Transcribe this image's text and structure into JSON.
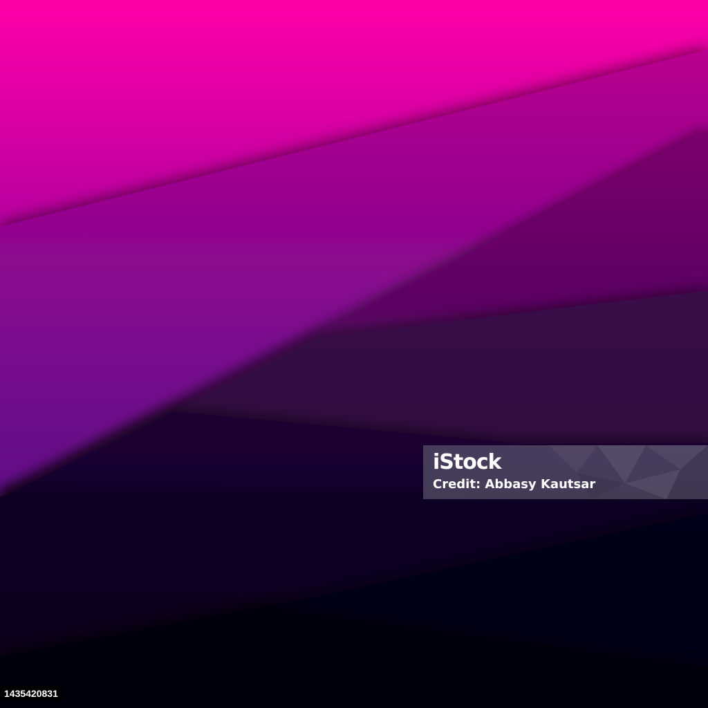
{
  "image": {
    "subject": "abstract layered paper shapes",
    "colors": {
      "magenta": "#ff00a8",
      "purple": "#5a0a8c",
      "deep_indigo": "#1a0a3a",
      "near_black": "#05020f"
    }
  },
  "watermark": {
    "logo_text": "iStock",
    "credit_text": "Credit: Abbasy Kautsar"
  },
  "image_id": {
    "text": "1435420831"
  }
}
